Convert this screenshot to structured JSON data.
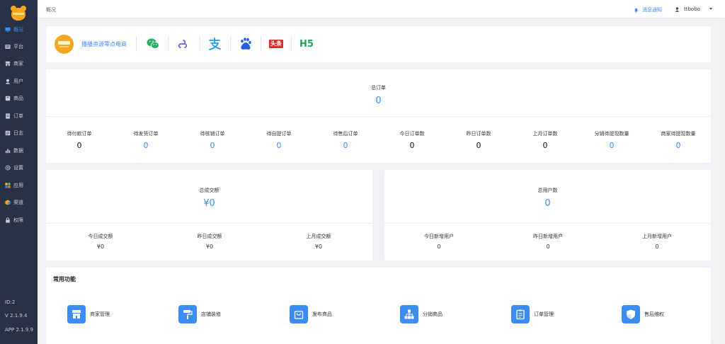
{
  "sidebar": {
    "items": [
      {
        "label": "概况",
        "icon": "monitor-icon",
        "active": true
      },
      {
        "label": "平台",
        "icon": "platform-icon"
      },
      {
        "label": "商家",
        "icon": "store-icon"
      },
      {
        "label": "用户",
        "icon": "user-icon"
      },
      {
        "label": "商品",
        "icon": "goods-icon"
      },
      {
        "label": "订单",
        "icon": "order-icon"
      },
      {
        "label": "日志",
        "icon": "log-icon"
      },
      {
        "label": "数据",
        "icon": "bar-chart-icon"
      },
      {
        "label": "设置",
        "icon": "gear-icon"
      },
      {
        "label": "应用",
        "icon": "apps-grid-icon"
      },
      {
        "label": "渠道",
        "icon": "channel-icon"
      },
      {
        "label": "权限",
        "icon": "lock-icon"
      }
    ],
    "footer": {
      "id": "ID:2",
      "version": "V 2.1.9.4",
      "app": "APP 2.1.9.9"
    }
  },
  "topbar": {
    "breadcrumb": "概况",
    "notice": "消息通知",
    "username": "ttbobo"
  },
  "platforms": {
    "brand_name": "播播资源零点电商",
    "items": [
      "wechat-icon",
      "mini-program-icon",
      "alipay-icon",
      "baidu-icon",
      "toutiao-icon",
      "h5-icon"
    ],
    "toutiao_label": "头条",
    "h5_label": "H5"
  },
  "orders": {
    "total_title": "总订单",
    "total_value": "0",
    "cells": [
      {
        "label": "待付款订单",
        "value": "0",
        "color": "black"
      },
      {
        "label": "待发货订单",
        "value": "0",
        "color": "blue"
      },
      {
        "label": "待核销订单",
        "value": "0",
        "color": "blue"
      },
      {
        "label": "待自提订单",
        "value": "0",
        "color": "blue"
      },
      {
        "label": "待售后订单",
        "value": "0",
        "color": "blue"
      },
      {
        "label": "今日订单数",
        "value": "0",
        "color": "black"
      },
      {
        "label": "昨日订单数",
        "value": "0",
        "color": "black"
      },
      {
        "label": "上月订单数",
        "value": "0",
        "color": "black"
      },
      {
        "label": "分销待提现数量",
        "value": "0",
        "color": "blue"
      },
      {
        "label": "商家待提现数量",
        "value": "0",
        "color": "blue"
      }
    ]
  },
  "turnover": {
    "total_title": "总成交额",
    "total_value": "¥0",
    "cells": [
      {
        "label": "今日成交额",
        "value": "¥0"
      },
      {
        "label": "昨日成交额",
        "value": "¥0"
      },
      {
        "label": "上月成交额",
        "value": "¥0"
      }
    ]
  },
  "users": {
    "total_title": "总用户数",
    "total_value": "0",
    "cells": [
      {
        "label": "今日新增用户",
        "value": "0"
      },
      {
        "label": "昨日新增用户",
        "value": "0"
      },
      {
        "label": "上月新增用户",
        "value": "0"
      }
    ]
  },
  "functions": {
    "title": "常用功能",
    "items": [
      {
        "label": "商家管理",
        "icon": "store-icon"
      },
      {
        "label": "店铺装修",
        "icon": "paint-roller-icon"
      },
      {
        "label": "发布商品",
        "icon": "shopping-bag-icon"
      },
      {
        "label": "分销商品",
        "icon": "hierarchy-icon"
      },
      {
        "label": "订单管理",
        "icon": "clipboard-icon"
      },
      {
        "label": "售后维权",
        "icon": "shield-icon"
      }
    ]
  },
  "colors": {
    "accent": "#3b8cf5",
    "sidebar": "#293145",
    "brand": "#f5a623"
  }
}
